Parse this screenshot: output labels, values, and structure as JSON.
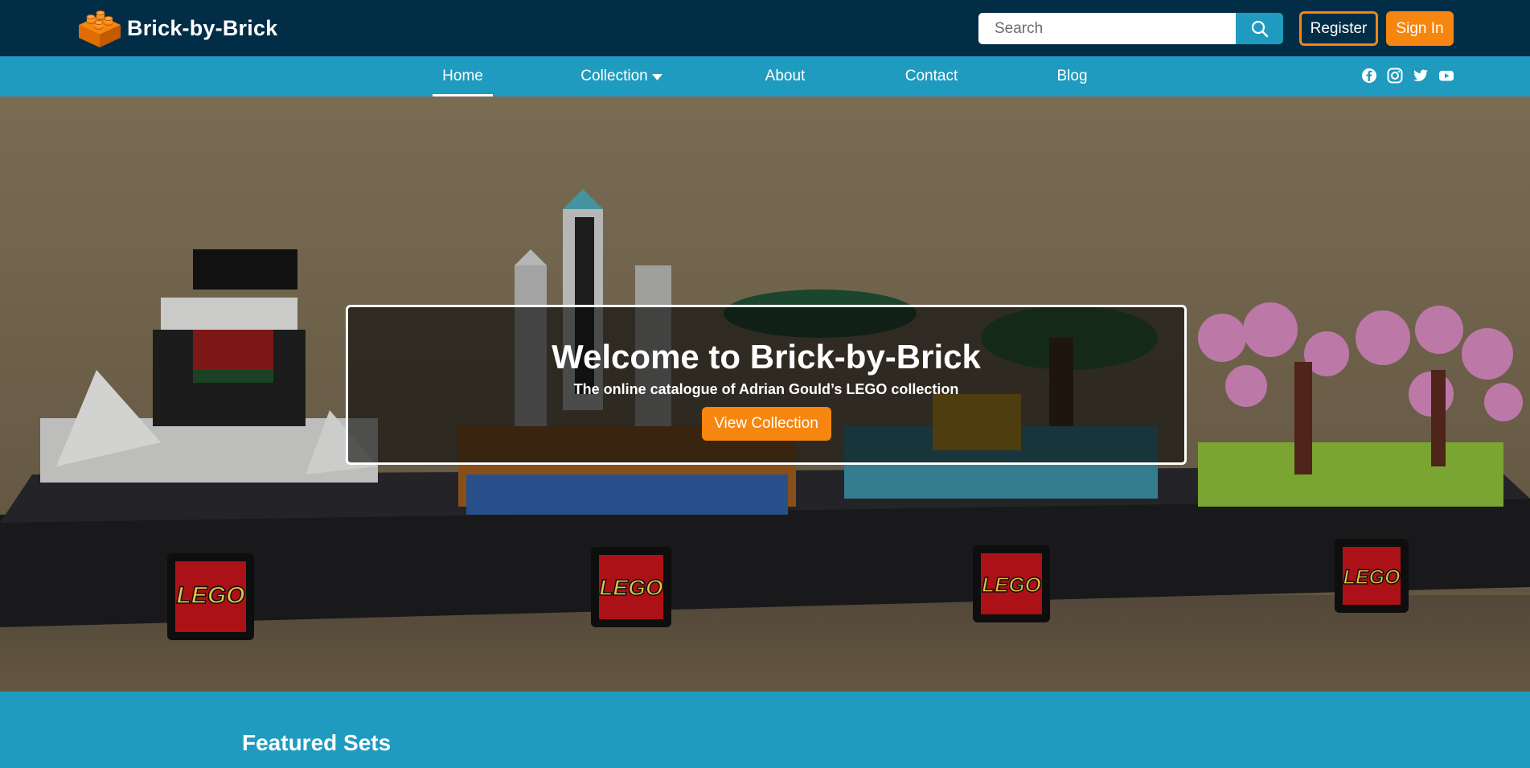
{
  "header": {
    "brand_name": "Brick-by-Brick",
    "search": {
      "placeholder": "Search",
      "value": ""
    },
    "register_label": "Register",
    "signin_label": "Sign In"
  },
  "nav": {
    "items": [
      {
        "label": "Home",
        "active": true
      },
      {
        "label": "Collection",
        "has_dropdown": true
      },
      {
        "label": "About"
      },
      {
        "label": "Contact"
      },
      {
        "label": "Blog"
      }
    ],
    "socials": [
      "facebook-icon",
      "instagram-icon",
      "twitter-icon",
      "youtube-icon"
    ]
  },
  "hero": {
    "title": "Welcome to Brick-by-Brick",
    "subtitle": "The online catalogue of Adrian Gould’s LEGO collection",
    "cta_label": "View Collection",
    "logo_text": "LEGO"
  },
  "featured": {
    "title": "Featured Sets"
  },
  "colors": {
    "topbar": "#022d47",
    "navbar": "#1f9bbf",
    "accent": "#f6860f",
    "white": "#ffffff"
  }
}
